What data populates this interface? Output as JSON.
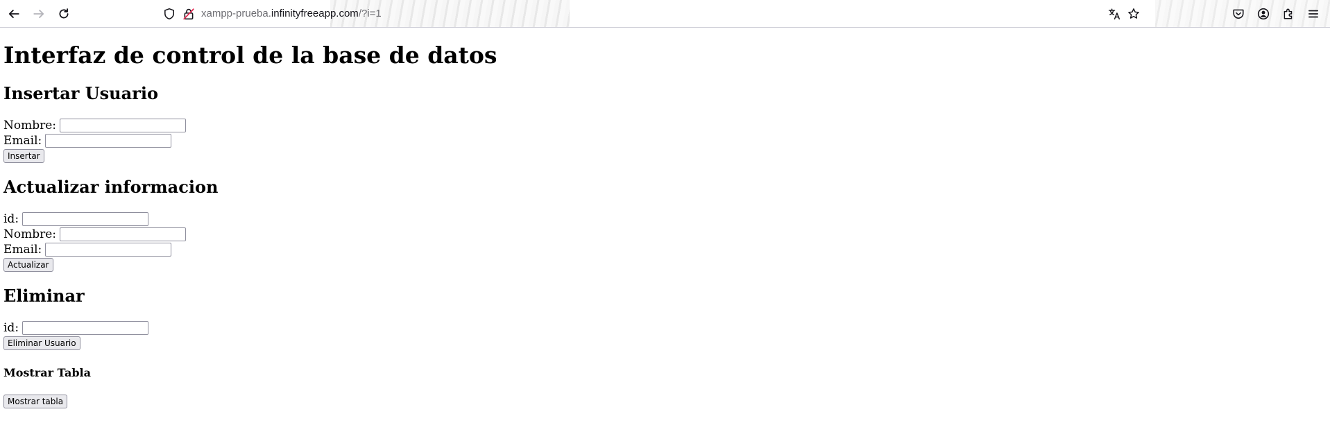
{
  "browser": {
    "url_prefix": "xampp-prueba.",
    "url_host": "infinityfreeapp.com",
    "url_path": "/?i=1",
    "icons": {
      "back": "back-arrow-icon",
      "forward": "forward-arrow-icon",
      "reload": "reload-icon",
      "tracking": "shield-icon",
      "insecure": "insecure-lock-icon",
      "translate": "translate-icon",
      "bookmark": "star-icon",
      "pocket": "pocket-icon",
      "account": "account-icon",
      "extensions": "extensions-icon",
      "menu": "hamburger-menu-icon"
    }
  },
  "page": {
    "title": "Interfaz de control de la base de datos",
    "insert": {
      "heading": "Insertar Usuario",
      "name_label": "Nombre:",
      "name_value": "",
      "email_label": "Email:",
      "email_value": "",
      "button": "Insertar"
    },
    "update": {
      "heading": "Actualizar informacion",
      "id_label": "id:",
      "id_value": "",
      "name_label": "Nombre:",
      "name_value": "",
      "email_label": "Email:",
      "email_value": "",
      "button": "Actualizar"
    },
    "delete": {
      "heading": "Eliminar",
      "id_label": "id:",
      "id_value": "",
      "button": "Eliminar Usuario"
    },
    "show": {
      "heading": "Mostrar Tabla",
      "button": "Mostrar tabla"
    }
  }
}
